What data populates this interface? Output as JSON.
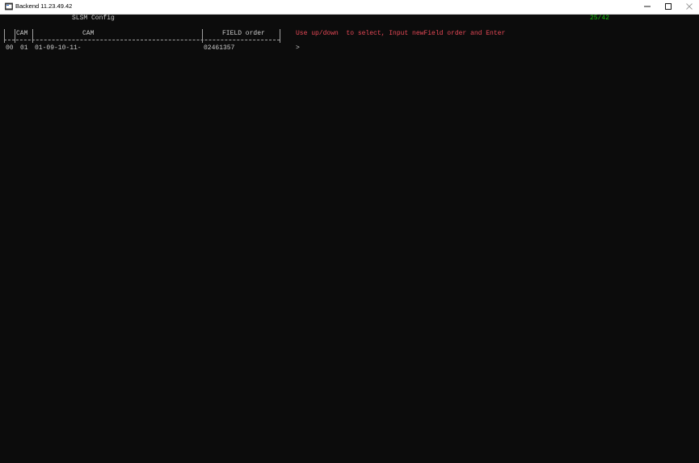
{
  "window": {
    "title": "Backend 11.23.49.42",
    "app_icon": "terminal-app-icon",
    "controls": {
      "minimize_icon": "minimize-icon",
      "maximize_icon": "maximize-icon",
      "close_icon": "close-icon"
    }
  },
  "screen": {
    "title": "SLSM Config",
    "page_counter": "25/42",
    "instructions": "Use up/down  to select, Input newField order and Enter",
    "table": {
      "columns": [
        "CAM",
        "CAM",
        "FIELD order"
      ],
      "rows": [
        {
          "index": "00",
          "cam_no": "01",
          "cam": "01-09-10-11-",
          "field_order": "02461357"
        }
      ]
    },
    "prompt": ">"
  },
  "colors": {
    "background": "#0c0c0c",
    "text": "#cccccc",
    "instructions": "#e74856",
    "counter": "#16c60c"
  }
}
